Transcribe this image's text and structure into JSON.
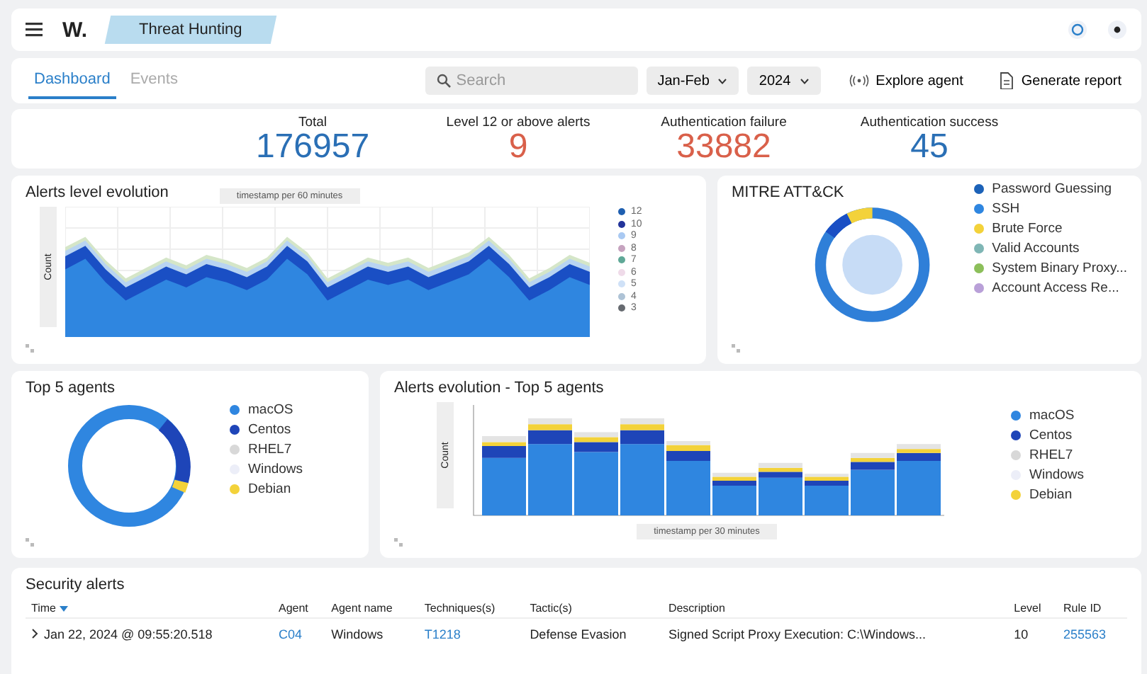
{
  "header": {
    "logo": "W.",
    "section": "Threat Hunting"
  },
  "tabs": [
    {
      "label": "Dashboard",
      "selected": true
    },
    {
      "label": "Events",
      "selected": false
    }
  ],
  "search": {
    "placeholder": "Search"
  },
  "filters": [
    {
      "value": "Jan-Feb"
    },
    {
      "value": "2024"
    }
  ],
  "actions": [
    {
      "label": "Explore agent",
      "kind": "agent"
    },
    {
      "label": "Generate report",
      "kind": "report"
    }
  ],
  "stats": [
    {
      "label": "Total",
      "value": "176957",
      "color": "#2a6fb5"
    },
    {
      "label": "Level 12 or above alerts",
      "value": "9",
      "color": "#d9604a"
    },
    {
      "label": "Authentication failure",
      "value": "33882",
      "color": "#d9604a"
    },
    {
      "label": "Authentication success",
      "value": "45",
      "color": "#2a6fb5"
    }
  ],
  "alerts_level": {
    "title": "Alerts level evolution",
    "xlabel": "timestamp per 60 minutes",
    "ylabel": "Count",
    "legend": [
      {
        "label": "12",
        "color": "#1f5fb0"
      },
      {
        "label": "10",
        "color": "#23349a"
      },
      {
        "label": "9",
        "color": "#a9c9f2"
      },
      {
        "label": "8",
        "color": "#c6a3bf"
      },
      {
        "label": "7",
        "color": "#5fa897"
      },
      {
        "label": "6",
        "color": "#efdbe9"
      },
      {
        "label": "5",
        "color": "#cfe1f7"
      },
      {
        "label": "4",
        "color": "#aec3d6"
      },
      {
        "label": "3",
        "color": "#666a70"
      }
    ]
  },
  "mitre": {
    "title": "MITRE ATT&CK",
    "legend": [
      {
        "label": "Password Guessing",
        "color": "#1c62b8"
      },
      {
        "label": "SSH",
        "color": "#2f86e0"
      },
      {
        "label": "Brute Force",
        "color": "#f3d23a"
      },
      {
        "label": "Valid Accounts",
        "color": "#7fb6b5"
      },
      {
        "label": "System Binary Proxy...",
        "color": "#8cbf5a"
      },
      {
        "label": "Account Access Re...",
        "color": "#b9a0d8"
      }
    ]
  },
  "top_agents": {
    "title": "Top 5 agents",
    "legend": [
      {
        "label": "macOS",
        "color": "#2f86e0"
      },
      {
        "label": "Centos",
        "color": "#1e45b8"
      },
      {
        "label": "RHEL7",
        "color": "#d8d8d8"
      },
      {
        "label": "Windows",
        "color": "#eceef8"
      },
      {
        "label": "Debian",
        "color": "#f3d23a"
      }
    ]
  },
  "agents_evolution": {
    "title": "Alerts evolution - Top 5 agents",
    "xlabel": "timestamp per 30 minutes",
    "ylabel": "Count",
    "legend": [
      {
        "label": "macOS",
        "color": "#2f86e0"
      },
      {
        "label": "Centos",
        "color": "#1e45b8"
      },
      {
        "label": "RHEL7",
        "color": "#d8d8d8"
      },
      {
        "label": "Windows",
        "color": "#eceef8"
      },
      {
        "label": "Debian",
        "color": "#f3d23a"
      }
    ]
  },
  "security_alerts": {
    "title": "Security alerts",
    "columns": [
      {
        "label": "Time",
        "sorted": true
      },
      {
        "label": "Agent",
        "sorted": false
      },
      {
        "label": "Agent name",
        "sorted": false
      },
      {
        "label": "Techniques(s)",
        "sorted": false
      },
      {
        "label": "Tactic(s)",
        "sorted": false
      },
      {
        "label": "Description",
        "sorted": false
      },
      {
        "label": "Level",
        "sorted": false
      },
      {
        "label": "Rule ID",
        "sorted": false
      }
    ],
    "rows": [
      {
        "expanded": false,
        "cells": [
          {
            "text": "Jan 22, 2024 @ 09:55:20.518",
            "link": false
          },
          {
            "text": "C04",
            "link": true
          },
          {
            "text": "Windows",
            "link": false
          },
          {
            "text": "T1218",
            "link": true
          },
          {
            "text": "Defense Evasion",
            "link": false
          },
          {
            "text": "Signed Script Proxy Execution: C:\\Windows...",
            "link": false
          },
          {
            "text": "10",
            "link": false
          },
          {
            "text": "255563",
            "link": true
          }
        ]
      }
    ]
  }
}
